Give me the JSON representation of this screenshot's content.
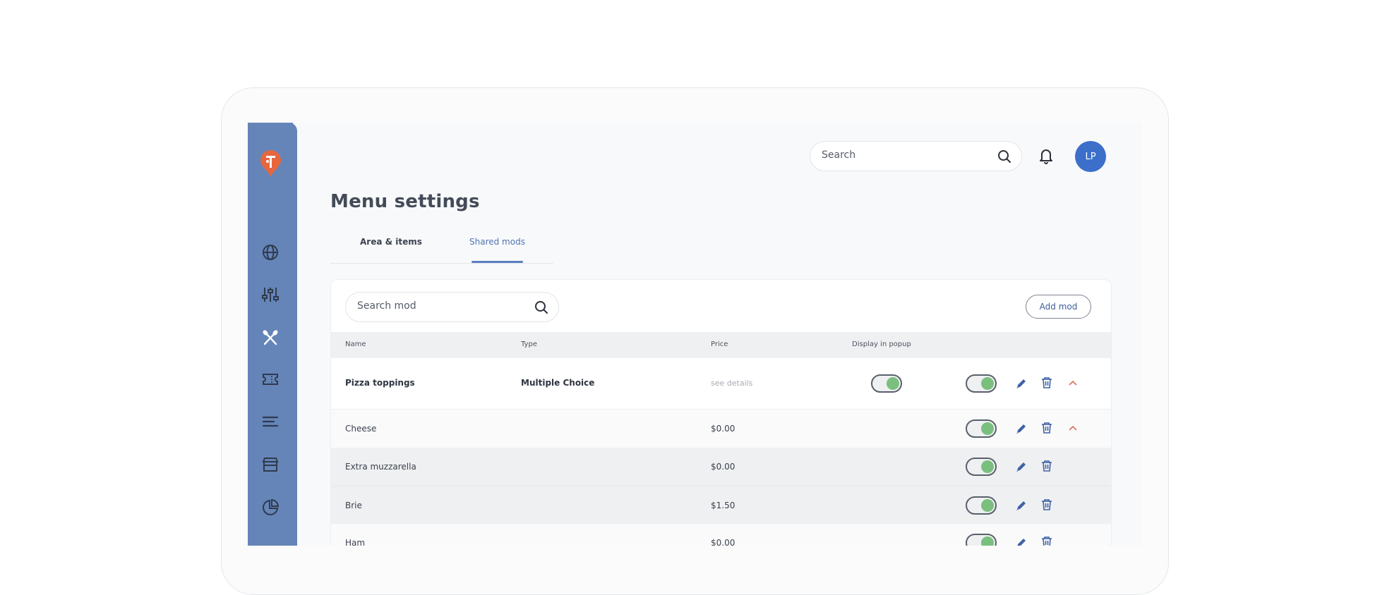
{
  "header": {
    "search_placeholder": "Search",
    "avatar_initials": "LP"
  },
  "page": {
    "title": "Menu settings",
    "tabs": [
      {
        "label": "Area & items",
        "active": false
      },
      {
        "label": "Shared mods",
        "active": true
      }
    ]
  },
  "mods": {
    "search_placeholder": "Search mod",
    "add_label": "Add mod",
    "columns": [
      "Name",
      "Type",
      "Price",
      "Display in popup"
    ],
    "rows": [
      {
        "name": "Pizza toppings",
        "type": "Multiple Choice",
        "price": "see details",
        "popup": true,
        "enabled": true,
        "expanded": true
      },
      {
        "name": "Cheese",
        "type": "",
        "price": "$0.00",
        "enabled": true,
        "expanded": true
      },
      {
        "name": "Extra muzzarella",
        "type": "",
        "price": "$0.00",
        "enabled": true
      },
      {
        "name": "Brie",
        "type": "",
        "price": "$1.50",
        "enabled": true
      },
      {
        "name": "Ham",
        "type": "",
        "price": "$0.00",
        "enabled": true
      }
    ]
  },
  "colors": {
    "sidebar": "#6585b8",
    "accent": "#4f73b5",
    "avatar": "#3b6fca",
    "toggle_on": "#7bbf7e",
    "chevron": "#d8705a",
    "logo": "#e8663d"
  },
  "icons": [
    "logo-icon",
    "globe-icon",
    "sliders-icon",
    "utensils-icon",
    "ticket-icon",
    "menu-lines-icon",
    "store-icon",
    "pie-chart-icon",
    "search-icon",
    "bell-icon",
    "pencil-icon",
    "trash-icon",
    "chevron-up-icon"
  ]
}
